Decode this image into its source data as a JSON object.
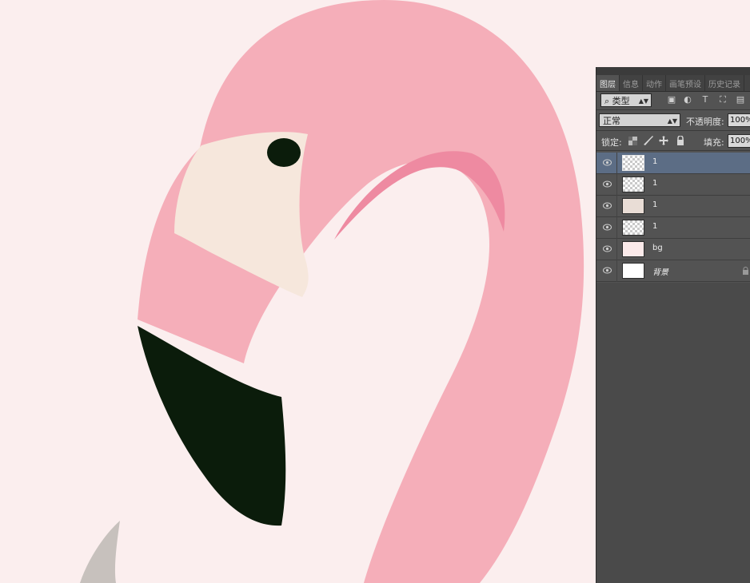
{
  "colors": {
    "background": "#fbeeee",
    "flamingo_pink": "#f5aeb9",
    "beak_cream": "#f6e7dc",
    "beak_tip": "#0b1c0b",
    "eye": "#0b1c0b",
    "accent_pink": "#ee8aa1",
    "panel": "#535353",
    "panel_dark": "#424242",
    "selected_layer": "#5c6d85"
  },
  "panel": {
    "tabs": [
      {
        "label": "图层",
        "active": true
      },
      {
        "label": "信息",
        "active": false
      },
      {
        "label": "动作",
        "active": false
      },
      {
        "label": "画笔预设",
        "active": false
      },
      {
        "label": "历史记录",
        "active": false
      }
    ],
    "filter": {
      "search_glyph": "⌕",
      "kind_label": "类型",
      "icons": [
        "image-filter-icon",
        "adjustment-filter-icon",
        "type-filter-icon",
        "shape-filter-icon",
        "smart-object-filter-icon"
      ]
    },
    "blend": {
      "mode": "正常",
      "opacity_label": "不透明度:",
      "opacity_value": "100%"
    },
    "lock": {
      "label": "锁定:",
      "fill_label": "填充:",
      "fill_value": "100%"
    },
    "layers": [
      {
        "name": "1",
        "thumb": "checker",
        "selected": true
      },
      {
        "name": "1",
        "thumb": "checker",
        "selected": false
      },
      {
        "name": "1",
        "thumb": "art",
        "selected": false
      },
      {
        "name": "1",
        "thumb": "checker",
        "selected": false
      },
      {
        "name": "bg",
        "thumb": "bgpink",
        "selected": false
      },
      {
        "name": "背景",
        "thumb": "white",
        "selected": false,
        "locked": true
      }
    ]
  }
}
